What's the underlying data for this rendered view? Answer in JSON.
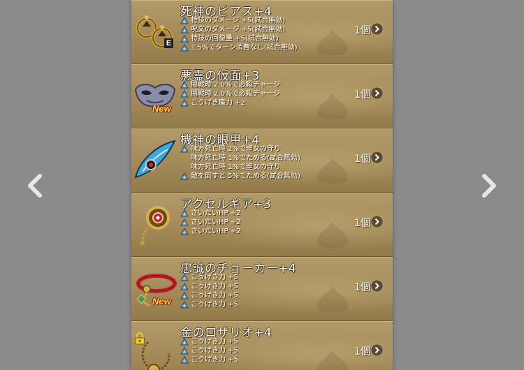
{
  "nav": {
    "prev_icon": "chevron-left-icon",
    "next_icon": "chevron-right-icon"
  },
  "items": [
    {
      "name": "死神のピアス+4",
      "count": "1個",
      "badge": "E",
      "effects": [
        "特技のダメージ +5(試合無効)",
        "呪文のダメージ +5(試合無効)",
        "特技の回復量 +5(試合無効)",
        "1.5%でターン消費なし(試合無効)"
      ]
    },
    {
      "name": "悪霊の仮面+3",
      "count": "1個",
      "badge": "New",
      "effects": [
        "開戦時 2.0%で必殺チャージ",
        "開戦時 2.0%で必殺チャージ",
        "こうげき魔力 +2"
      ]
    },
    {
      "name": "機神の眼甲+4",
      "count": "1個",
      "effects": [
        "味方死亡時 2%で聖女の守り",
        "味方死亡時 1%でためる(試合無効)",
        "味方死亡時 1%で聖女の守り",
        "敵を倒すと 5%でためる(試合無効)"
      ]
    },
    {
      "name": "アクセルギア+3",
      "count": "1個",
      "effects": [
        "さいだいHP +2",
        "さいだいHP +2",
        "さいだいHP +2"
      ]
    },
    {
      "name": "忠誠のチョーカー+4",
      "count": "1個",
      "badge": "New",
      "effects": [
        "こうげき力 +5",
        "こうげき力 +5",
        "こうげき力 +5",
        "こうげき力 +5"
      ]
    },
    {
      "name": "金のロザリオ+4",
      "count": "1個",
      "locked": true,
      "effects": [
        "こうげき力 +5",
        "こうげき力 +5",
        "こうげき力 +5"
      ]
    }
  ]
}
